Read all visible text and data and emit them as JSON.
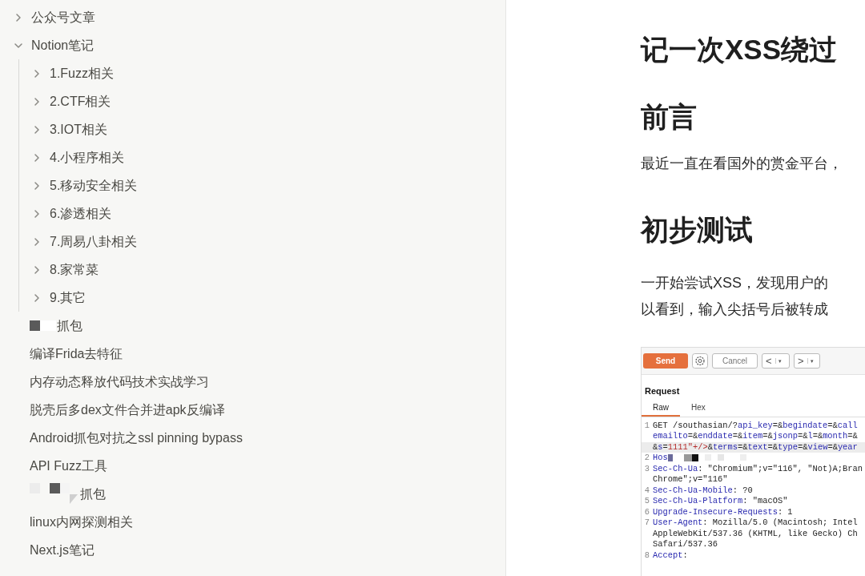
{
  "sidebar": {
    "items": [
      {
        "kind": "folder",
        "label": "公众号文章",
        "expanded": false
      },
      {
        "kind": "folder",
        "label": "Notion笔记",
        "expanded": true,
        "children": [
          {
            "label": "1.Fuzz相关",
            "expanded": false
          },
          {
            "label": "2.CTF相关",
            "expanded": false
          },
          {
            "label": "3.IOT相关",
            "expanded": false
          },
          {
            "label": "4.小程序相关",
            "expanded": false
          },
          {
            "label": "5.移动安全相关",
            "expanded": false
          },
          {
            "label": "6.渗透相关",
            "expanded": false
          },
          {
            "label": "7.周易八卦相关",
            "expanded": false
          },
          {
            "label": "8.家常菜",
            "expanded": false
          },
          {
            "label": "9.其它",
            "expanded": false
          }
        ]
      },
      {
        "kind": "redacted",
        "label": "抓包"
      },
      {
        "kind": "page",
        "label": "编译Frida去特征"
      },
      {
        "kind": "page",
        "label": "内存动态释放代码技术实战学习"
      },
      {
        "kind": "page",
        "label": "脱壳后多dex文件合并进apk反编译"
      },
      {
        "kind": "page",
        "label": "Android抓包对抗之ssl pinning bypass"
      },
      {
        "kind": "page",
        "label": "API Fuzz工具"
      },
      {
        "kind": "redacted",
        "label": "抓包"
      },
      {
        "kind": "page",
        "label": "linux内网探测相关"
      },
      {
        "kind": "page",
        "label": "Next.js笔记"
      }
    ]
  },
  "document": {
    "title": "记一次XSS绕过",
    "sections": [
      {
        "heading": "前言",
        "lines": [
          "最近一直在看国外的赏金平台，"
        ]
      },
      {
        "heading": "初步测试",
        "lines": [
          "一开始尝试XSS，发现用户的",
          "以看到，输入尖括号后被转成"
        ]
      }
    ],
    "screenshot": {
      "toolbar": {
        "send": "Send",
        "cancel": "Cancel",
        "back": "<",
        "forward": ">",
        "dropdown": "▾"
      },
      "panel_title": "Request",
      "tabs": [
        {
          "label": "Raw",
          "selected": true
        },
        {
          "label": "Hex",
          "selected": false
        }
      ],
      "lines": [
        {
          "number": "1",
          "highlighted": false,
          "parts": [
            {
              "kind": "plain",
              "t": "GET /southasian/?"
            },
            {
              "kind": "key",
              "t": "api_key"
            },
            {
              "kind": "plain",
              "t": "=&"
            },
            {
              "kind": "key",
              "t": "begindate"
            },
            {
              "kind": "plain",
              "t": "=&"
            },
            {
              "kind": "key",
              "t": "call"
            }
          ]
        },
        {
          "highlighted": false,
          "parts": [
            {
              "kind": "key",
              "t": "emailto"
            },
            {
              "kind": "plain",
              "t": "=&"
            },
            {
              "kind": "key",
              "t": "enddate"
            },
            {
              "kind": "plain",
              "t": "=&"
            },
            {
              "kind": "key",
              "t": "item"
            },
            {
              "kind": "plain",
              "t": "=&"
            },
            {
              "kind": "key",
              "t": "jsonp"
            },
            {
              "kind": "plain",
              "t": "=&"
            },
            {
              "kind": "key",
              "t": "l"
            },
            {
              "kind": "plain",
              "t": "=&"
            },
            {
              "kind": "key",
              "t": "month"
            },
            {
              "kind": "plain",
              "t": "=&"
            }
          ]
        },
        {
          "highlighted": true,
          "parts": [
            {
              "kind": "plain",
              "t": "&"
            },
            {
              "kind": "key",
              "t": "s"
            },
            {
              "kind": "plain",
              "t": "="
            },
            {
              "kind": "value",
              "t": "1111\"+/>"
            },
            {
              "kind": "plain",
              "t": "&"
            },
            {
              "kind": "key",
              "t": "terms"
            },
            {
              "kind": "plain",
              "t": "=&"
            },
            {
              "kind": "key",
              "t": "text"
            },
            {
              "kind": "plain",
              "t": "=&"
            },
            {
              "kind": "key",
              "t": "type"
            },
            {
              "kind": "plain",
              "t": "=&"
            },
            {
              "kind": "key",
              "t": "view"
            },
            {
              "kind": "plain",
              "t": "=&"
            },
            {
              "kind": "key",
              "t": "year"
            }
          ]
        },
        {
          "number": "2",
          "highlighted": false,
          "redacted": true,
          "parts": [
            {
              "kind": "key",
              "t": "Hos"
            }
          ]
        },
        {
          "number": "3",
          "highlighted": false,
          "parts": [
            {
              "kind": "key",
              "t": "Sec-Ch-Ua"
            },
            {
              "kind": "plain",
              "t": ": \"Chromium\";v=\"116\", \"Not)A;Bran"
            }
          ]
        },
        {
          "highlighted": false,
          "parts": [
            {
              "kind": "plain",
              "t": "Chrome\";v=\"116\""
            }
          ]
        },
        {
          "number": "4",
          "highlighted": false,
          "parts": [
            {
              "kind": "key",
              "t": "Sec-Ch-Ua-Mobile"
            },
            {
              "kind": "plain",
              "t": ": ?0"
            }
          ]
        },
        {
          "number": "5",
          "highlighted": false,
          "parts": [
            {
              "kind": "key",
              "t": "Sec-Ch-Ua-Platform"
            },
            {
              "kind": "plain",
              "t": ": \"macOS\""
            }
          ]
        },
        {
          "number": "6",
          "highlighted": false,
          "parts": [
            {
              "kind": "key",
              "t": "Upgrade-Insecure-Requests"
            },
            {
              "kind": "plain",
              "t": ": 1"
            }
          ]
        },
        {
          "number": "7",
          "highlighted": false,
          "parts": [
            {
              "kind": "key",
              "t": "User-Agent"
            },
            {
              "kind": "plain",
              "t": ": Mozilla/5.0 (Macintosh; Intel"
            }
          ]
        },
        {
          "highlighted": false,
          "parts": [
            {
              "kind": "plain",
              "t": "AppleWebKit/537.36 (KHTML, like Gecko) Ch"
            }
          ]
        },
        {
          "highlighted": false,
          "parts": [
            {
              "kind": "plain",
              "t": "Safari/537.36"
            }
          ]
        },
        {
          "number": "8",
          "highlighted": false,
          "parts": [
            {
              "kind": "key",
              "t": "Accept"
            },
            {
              "kind": "plain",
              "t": ":"
            }
          ]
        }
      ]
    }
  }
}
